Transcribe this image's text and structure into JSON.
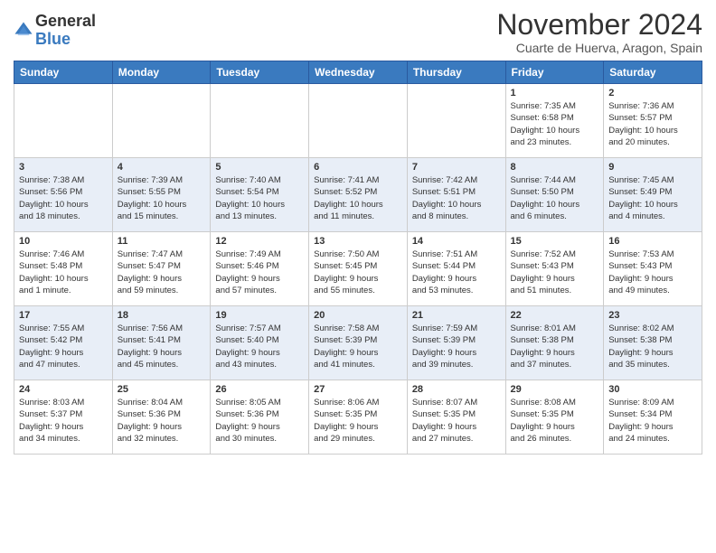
{
  "logo": {
    "general": "General",
    "blue": "Blue"
  },
  "header": {
    "month_title": "November 2024",
    "location": "Cuarte de Huerva, Aragon, Spain"
  },
  "weekdays": [
    "Sunday",
    "Monday",
    "Tuesday",
    "Wednesday",
    "Thursday",
    "Friday",
    "Saturday"
  ],
  "weeks": [
    [
      {
        "day": "",
        "info": ""
      },
      {
        "day": "",
        "info": ""
      },
      {
        "day": "",
        "info": ""
      },
      {
        "day": "",
        "info": ""
      },
      {
        "day": "",
        "info": ""
      },
      {
        "day": "1",
        "info": "Sunrise: 7:35 AM\nSunset: 6:58 PM\nDaylight: 10 hours\nand 23 minutes."
      },
      {
        "day": "2",
        "info": "Sunrise: 7:36 AM\nSunset: 5:57 PM\nDaylight: 10 hours\nand 20 minutes."
      }
    ],
    [
      {
        "day": "3",
        "info": "Sunrise: 7:38 AM\nSunset: 5:56 PM\nDaylight: 10 hours\nand 18 minutes."
      },
      {
        "day": "4",
        "info": "Sunrise: 7:39 AM\nSunset: 5:55 PM\nDaylight: 10 hours\nand 15 minutes."
      },
      {
        "day": "5",
        "info": "Sunrise: 7:40 AM\nSunset: 5:54 PM\nDaylight: 10 hours\nand 13 minutes."
      },
      {
        "day": "6",
        "info": "Sunrise: 7:41 AM\nSunset: 5:52 PM\nDaylight: 10 hours\nand 11 minutes."
      },
      {
        "day": "7",
        "info": "Sunrise: 7:42 AM\nSunset: 5:51 PM\nDaylight: 10 hours\nand 8 minutes."
      },
      {
        "day": "8",
        "info": "Sunrise: 7:44 AM\nSunset: 5:50 PM\nDaylight: 10 hours\nand 6 minutes."
      },
      {
        "day": "9",
        "info": "Sunrise: 7:45 AM\nSunset: 5:49 PM\nDaylight: 10 hours\nand 4 minutes."
      }
    ],
    [
      {
        "day": "10",
        "info": "Sunrise: 7:46 AM\nSunset: 5:48 PM\nDaylight: 10 hours\nand 1 minute."
      },
      {
        "day": "11",
        "info": "Sunrise: 7:47 AM\nSunset: 5:47 PM\nDaylight: 9 hours\nand 59 minutes."
      },
      {
        "day": "12",
        "info": "Sunrise: 7:49 AM\nSunset: 5:46 PM\nDaylight: 9 hours\nand 57 minutes."
      },
      {
        "day": "13",
        "info": "Sunrise: 7:50 AM\nSunset: 5:45 PM\nDaylight: 9 hours\nand 55 minutes."
      },
      {
        "day": "14",
        "info": "Sunrise: 7:51 AM\nSunset: 5:44 PM\nDaylight: 9 hours\nand 53 minutes."
      },
      {
        "day": "15",
        "info": "Sunrise: 7:52 AM\nSunset: 5:43 PM\nDaylight: 9 hours\nand 51 minutes."
      },
      {
        "day": "16",
        "info": "Sunrise: 7:53 AM\nSunset: 5:43 PM\nDaylight: 9 hours\nand 49 minutes."
      }
    ],
    [
      {
        "day": "17",
        "info": "Sunrise: 7:55 AM\nSunset: 5:42 PM\nDaylight: 9 hours\nand 47 minutes."
      },
      {
        "day": "18",
        "info": "Sunrise: 7:56 AM\nSunset: 5:41 PM\nDaylight: 9 hours\nand 45 minutes."
      },
      {
        "day": "19",
        "info": "Sunrise: 7:57 AM\nSunset: 5:40 PM\nDaylight: 9 hours\nand 43 minutes."
      },
      {
        "day": "20",
        "info": "Sunrise: 7:58 AM\nSunset: 5:39 PM\nDaylight: 9 hours\nand 41 minutes."
      },
      {
        "day": "21",
        "info": "Sunrise: 7:59 AM\nSunset: 5:39 PM\nDaylight: 9 hours\nand 39 minutes."
      },
      {
        "day": "22",
        "info": "Sunrise: 8:01 AM\nSunset: 5:38 PM\nDaylight: 9 hours\nand 37 minutes."
      },
      {
        "day": "23",
        "info": "Sunrise: 8:02 AM\nSunset: 5:38 PM\nDaylight: 9 hours\nand 35 minutes."
      }
    ],
    [
      {
        "day": "24",
        "info": "Sunrise: 8:03 AM\nSunset: 5:37 PM\nDaylight: 9 hours\nand 34 minutes."
      },
      {
        "day": "25",
        "info": "Sunrise: 8:04 AM\nSunset: 5:36 PM\nDaylight: 9 hours\nand 32 minutes."
      },
      {
        "day": "26",
        "info": "Sunrise: 8:05 AM\nSunset: 5:36 PM\nDaylight: 9 hours\nand 30 minutes."
      },
      {
        "day": "27",
        "info": "Sunrise: 8:06 AM\nSunset: 5:35 PM\nDaylight: 9 hours\nand 29 minutes."
      },
      {
        "day": "28",
        "info": "Sunrise: 8:07 AM\nSunset: 5:35 PM\nDaylight: 9 hours\nand 27 minutes."
      },
      {
        "day": "29",
        "info": "Sunrise: 8:08 AM\nSunset: 5:35 PM\nDaylight: 9 hours\nand 26 minutes."
      },
      {
        "day": "30",
        "info": "Sunrise: 8:09 AM\nSunset: 5:34 PM\nDaylight: 9 hours\nand 24 minutes."
      }
    ]
  ]
}
